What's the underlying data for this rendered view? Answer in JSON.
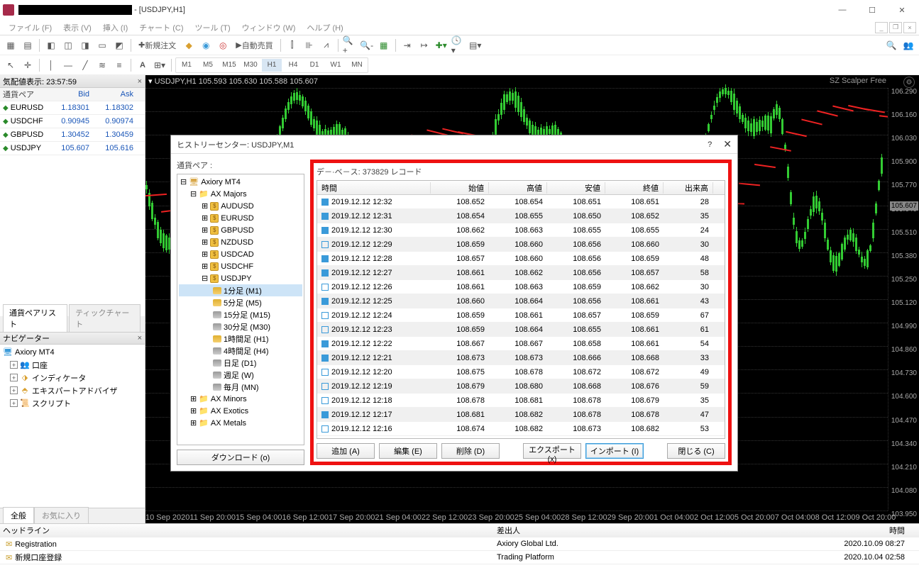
{
  "titlebar": {
    "suffix": "- [USDJPY,H1]"
  },
  "menus": [
    "ファイル (F)",
    "表示 (V)",
    "挿入 (I)",
    "チャート (C)",
    "ツール (T)",
    "ウィンドウ (W)",
    "ヘルプ (H)"
  ],
  "toolbar1": {
    "new_order": "新規注文",
    "auto_trade": "自動売買"
  },
  "toolbar2": {
    "timeframes": [
      "M1",
      "M5",
      "M15",
      "M30",
      "H1",
      "H4",
      "D1",
      "W1",
      "MN"
    ],
    "active_tf": "H1"
  },
  "market_watch": {
    "title": "気配値表示: 23:57:59",
    "headers": [
      "通貨ペア",
      "Bid",
      "Ask"
    ],
    "rows": [
      {
        "sym": "EURUSD",
        "bid": "1.18301",
        "ask": "1.18302"
      },
      {
        "sym": "USDCHF",
        "bid": "0.90945",
        "ask": "0.90974"
      },
      {
        "sym": "GBPUSD",
        "bid": "1.30452",
        "ask": "1.30459"
      },
      {
        "sym": "USDJPY",
        "bid": "105.607",
        "ask": "105.616"
      }
    ],
    "tabs": [
      "通貨ペアリスト",
      "ティックチャート"
    ]
  },
  "navigator": {
    "title": "ナビゲーター",
    "root": "Axiory MT4",
    "items": [
      "口座",
      "インディケータ",
      "エキスパートアドバイザ",
      "スクリプト"
    ],
    "tabs": [
      "全般",
      "お気に入り"
    ]
  },
  "chart": {
    "symbol_line": "USDJPY,H1 105.593 105.630 105.588 105.607",
    "indicator": "SZ Scalper Free",
    "price_ticks": [
      "106.290",
      "106.160",
      "106.030",
      "105.900",
      "105.770",
      "105.640",
      "105.510",
      "105.380",
      "105.250",
      "105.120",
      "104.990",
      "104.860",
      "104.730",
      "104.600",
      "104.470",
      "104.340",
      "104.210",
      "104.080",
      "103.950"
    ],
    "current_price": "105.607",
    "time_ticks": [
      "10 Sep 2020",
      "11 Sep 20:00",
      "15 Sep 04:00",
      "16 Sep 12:00",
      "17 Sep 20:00",
      "21 Sep 04:00",
      "22 Sep 12:00",
      "23 Sep 20:00",
      "25 Sep 04:00",
      "28 Sep 12:00",
      "29 Sep 20:00",
      "1 Oct 04:00",
      "2 Oct 12:00",
      "5 Oct 20:00",
      "7 Oct 04:00",
      "8 Oct 12:00",
      "9 Oct 20:00"
    ]
  },
  "dialog": {
    "title": "ヒストリーセンター: USDJPY,M1",
    "pair_label": "通貨ペア :",
    "db_label": "デ－·ベ－ス: 373829 レコード",
    "tree": {
      "root": "Axiory MT4",
      "group": "AX Majors",
      "symbols": [
        "AUDUSD",
        "EURUSD",
        "GBPUSD",
        "NZDUSD",
        "USDCAD",
        "USDCHF"
      ],
      "open_symbol": "USDJPY",
      "periods": [
        {
          "label": "1分足 (M1)",
          "sel": true,
          "gold": true
        },
        {
          "label": "5分足 (M5)",
          "gold": true
        },
        {
          "label": "15分足 (M15)"
        },
        {
          "label": "30分足 (M30)"
        },
        {
          "label": "1時間足 (H1)",
          "gold": true
        },
        {
          "label": "4時間足 (H4)"
        },
        {
          "label": "日足 (D1)"
        },
        {
          "label": "週足 (W)"
        },
        {
          "label": "毎月 (MN)"
        }
      ],
      "other_groups": [
        "AX Minors",
        "AX Exotics",
        "AX Metals"
      ]
    },
    "download_btn": "ダウンロード (o)",
    "columns": [
      "時間",
      "始値",
      "高値",
      "安値",
      "終値",
      "出来高"
    ],
    "rows": [
      {
        "t": "2019.12.12 12:32",
        "o": "108.652",
        "h": "108.654",
        "l": "108.651",
        "c": "108.651",
        "v": "28",
        "up": true
      },
      {
        "t": "2019.12.12 12:31",
        "o": "108.654",
        "h": "108.655",
        "l": "108.650",
        "c": "108.652",
        "v": "35",
        "up": true
      },
      {
        "t": "2019.12.12 12:30",
        "o": "108.662",
        "h": "108.663",
        "l": "108.655",
        "c": "108.655",
        "v": "24",
        "up": true
      },
      {
        "t": "2019.12.12 12:29",
        "o": "108.659",
        "h": "108.660",
        "l": "108.656",
        "c": "108.660",
        "v": "30",
        "up": false
      },
      {
        "t": "2019.12.12 12:28",
        "o": "108.657",
        "h": "108.660",
        "l": "108.656",
        "c": "108.659",
        "v": "48",
        "up": true
      },
      {
        "t": "2019.12.12 12:27",
        "o": "108.661",
        "h": "108.662",
        "l": "108.656",
        "c": "108.657",
        "v": "58",
        "up": true
      },
      {
        "t": "2019.12.12 12:26",
        "o": "108.661",
        "h": "108.663",
        "l": "108.659",
        "c": "108.662",
        "v": "30",
        "up": false
      },
      {
        "t": "2019.12.12 12:25",
        "o": "108.660",
        "h": "108.664",
        "l": "108.656",
        "c": "108.661",
        "v": "43",
        "up": true
      },
      {
        "t": "2019.12.12 12:24",
        "o": "108.659",
        "h": "108.661",
        "l": "108.657",
        "c": "108.659",
        "v": "67",
        "up": false
      },
      {
        "t": "2019.12.12 12:23",
        "o": "108.659",
        "h": "108.664",
        "l": "108.655",
        "c": "108.661",
        "v": "61",
        "up": false
      },
      {
        "t": "2019.12.12 12:22",
        "o": "108.667",
        "h": "108.667",
        "l": "108.658",
        "c": "108.661",
        "v": "54",
        "up": true
      },
      {
        "t": "2019.12.12 12:21",
        "o": "108.673",
        "h": "108.673",
        "l": "108.666",
        "c": "108.668",
        "v": "33",
        "up": true
      },
      {
        "t": "2019.12.12 12:20",
        "o": "108.675",
        "h": "108.678",
        "l": "108.672",
        "c": "108.672",
        "v": "49",
        "up": false
      },
      {
        "t": "2019.12.12 12:19",
        "o": "108.679",
        "h": "108.680",
        "l": "108.668",
        "c": "108.676",
        "v": "59",
        "up": false
      },
      {
        "t": "2019.12.12 12:18",
        "o": "108.678",
        "h": "108.681",
        "l": "108.678",
        "c": "108.679",
        "v": "35",
        "up": false
      },
      {
        "t": "2019.12.12 12:17",
        "o": "108.681",
        "h": "108.682",
        "l": "108.678",
        "c": "108.678",
        "v": "47",
        "up": true
      },
      {
        "t": "2019.12.12 12:16",
        "o": "108.674",
        "h": "108.682",
        "l": "108.673",
        "c": "108.682",
        "v": "53",
        "up": false
      }
    ],
    "buttons": {
      "add": "追加 (A)",
      "edit": "編集 (E)",
      "delete": "削除 (D)",
      "export": "エクスポート (x)",
      "import": "インポート (I)",
      "close": "閉じる (C)"
    }
  },
  "terminal": {
    "headers": [
      "ヘッドライン",
      "差出人",
      "時間"
    ],
    "rows": [
      {
        "h": "Registration",
        "s": "Axiory Global Ltd.",
        "t": "2020.10.09 08:27"
      },
      {
        "h": "新規口座登録",
        "s": "Trading Platform",
        "t": "2020.10.04 02:58"
      }
    ]
  }
}
